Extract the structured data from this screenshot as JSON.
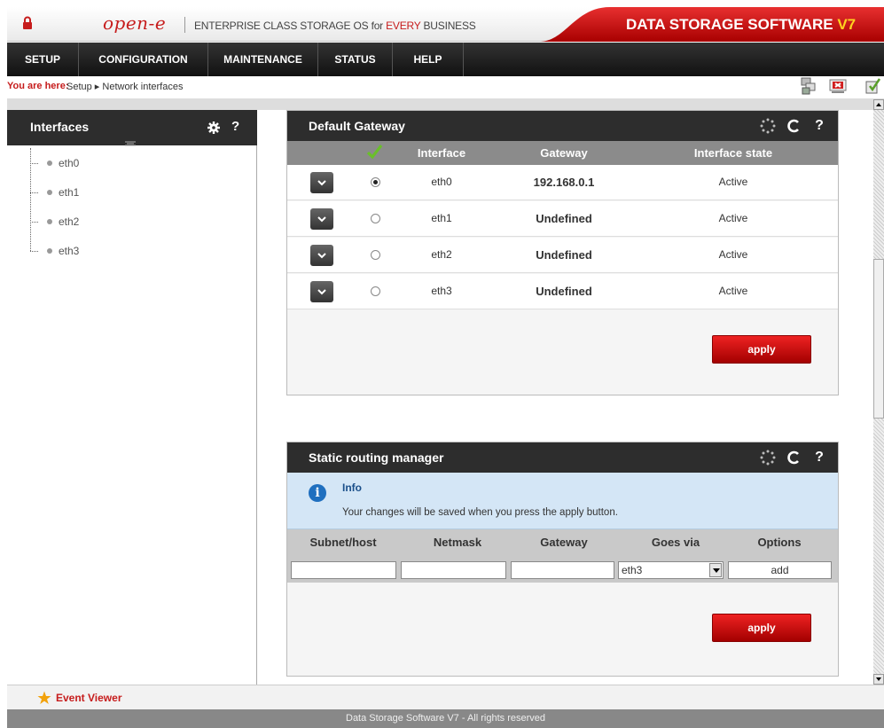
{
  "header": {
    "logo": "open-e",
    "tagline_prefix": "ENTERPRISE CLASS STORAGE OS for ",
    "tagline_highlight": "EVERY",
    "tagline_suffix": " BUSINESS",
    "product_title": "DATA STORAGE SOFTWARE ",
    "product_version": "V7"
  },
  "nav": {
    "items": [
      "SETUP",
      "CONFIGURATION",
      "MAINTENANCE",
      "STATUS",
      "HELP"
    ]
  },
  "breadcrumb": {
    "label": "You are here:",
    "path": "Setup ▸ Network interfaces"
  },
  "sidebar": {
    "title": "Interfaces",
    "items": [
      "eth0",
      "eth1",
      "eth2",
      "eth3"
    ]
  },
  "gateway_panel": {
    "title": "Default Gateway",
    "columns": [
      "Interface",
      "Gateway",
      "Interface state"
    ],
    "rows": [
      {
        "interface": "eth0",
        "gateway": "192.168.0.1",
        "state": "Active",
        "selected": true
      },
      {
        "interface": "eth1",
        "gateway": "Undefined",
        "state": "Active",
        "selected": false
      },
      {
        "interface": "eth2",
        "gateway": "Undefined",
        "state": "Active",
        "selected": false
      },
      {
        "interface": "eth3",
        "gateway": "Undefined",
        "state": "Active",
        "selected": false
      }
    ],
    "apply_label": "apply"
  },
  "routing_panel": {
    "title": "Static routing manager",
    "info_title": "Info",
    "info_text": "Your changes will be saved when you press the apply button.",
    "columns": [
      "Subnet/host",
      "Netmask",
      "Gateway",
      "Goes via",
      "Options"
    ],
    "inputs": {
      "subnet": "",
      "netmask": "",
      "gateway": ""
    },
    "goes_via_selected": "eth3",
    "add_label": "add",
    "apply_label": "apply"
  },
  "bottom": {
    "event_viewer": "Event Viewer",
    "footer": "Data Storage Software V7 - All rights reserved"
  },
  "colors": {
    "brand_red": "#c61c1c",
    "header_dark": "#2d2d2d",
    "info_bg": "#d4e6f6",
    "check_green": "#6abf2a"
  }
}
